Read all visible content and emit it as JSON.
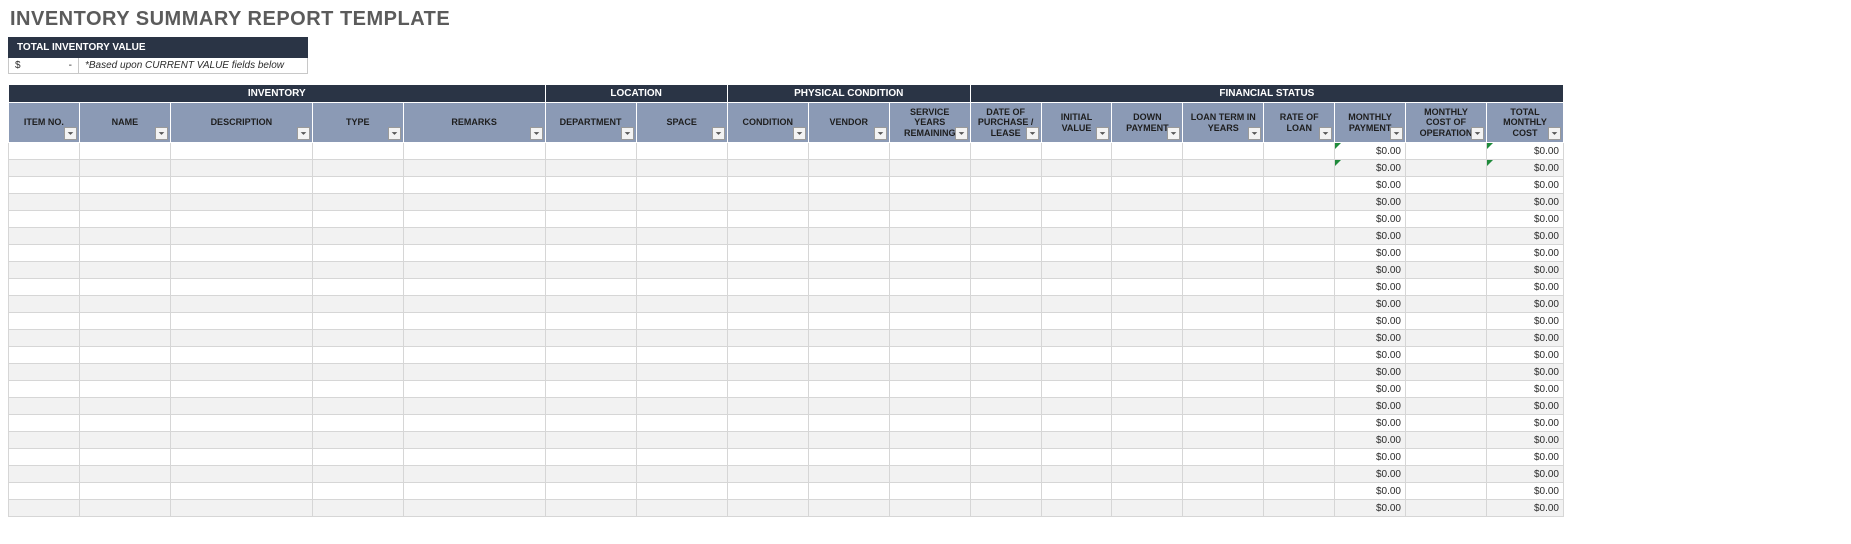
{
  "title": "INVENTORY SUMMARY REPORT TEMPLATE",
  "tiv": {
    "label": "TOTAL INVENTORY VALUE",
    "currency": "$",
    "value": "-",
    "note": "*Based upon CURRENT VALUE fields below"
  },
  "groups": {
    "inventory": "INVENTORY",
    "location": "LOCATION",
    "physical": "PHYSICAL CONDITION",
    "financial": "FINANCIAL STATUS"
  },
  "headers": {
    "itemno": "ITEM NO.",
    "name": "NAME",
    "description": "DESCRIPTION",
    "type": "TYPE",
    "remarks": "REMARKS",
    "department": "DEPARTMENT",
    "space": "SPACE",
    "condition": "CONDITION",
    "vendor": "VENDOR",
    "svcyears": "SERVICE YEARS REMAINING",
    "date": "DATE OF PURCHASE / LEASE",
    "initval": "INITIAL VALUE",
    "downpay": "DOWN PAYMENT",
    "loanterm": "LOAN TERM IN YEARS",
    "rate": "RATE OF LOAN",
    "mpay": "MONTHLY PAYMENT",
    "mcost": "MONTHLY COST OF OPERATION",
    "total": "TOTAL MONTHLY COST"
  },
  "rows": [
    {
      "mpay": "$0.00",
      "mcost": "",
      "total": "$0.00",
      "flag": true
    },
    {
      "mpay": "$0.00",
      "mcost": "",
      "total": "$0.00",
      "flag": true
    },
    {
      "mpay": "$0.00",
      "mcost": "",
      "total": "$0.00",
      "flag": false
    },
    {
      "mpay": "$0.00",
      "mcost": "",
      "total": "$0.00",
      "flag": false
    },
    {
      "mpay": "$0.00",
      "mcost": "",
      "total": "$0.00",
      "flag": false
    },
    {
      "mpay": "$0.00",
      "mcost": "",
      "total": "$0.00",
      "flag": false
    },
    {
      "mpay": "$0.00",
      "mcost": "",
      "total": "$0.00",
      "flag": false
    },
    {
      "mpay": "$0.00",
      "mcost": "",
      "total": "$0.00",
      "flag": false
    },
    {
      "mpay": "$0.00",
      "mcost": "",
      "total": "$0.00",
      "flag": false
    },
    {
      "mpay": "$0.00",
      "mcost": "",
      "total": "$0.00",
      "flag": false
    },
    {
      "mpay": "$0.00",
      "mcost": "",
      "total": "$0.00",
      "flag": false
    },
    {
      "mpay": "$0.00",
      "mcost": "",
      "total": "$0.00",
      "flag": false
    },
    {
      "mpay": "$0.00",
      "mcost": "",
      "total": "$0.00",
      "flag": false
    },
    {
      "mpay": "$0.00",
      "mcost": "",
      "total": "$0.00",
      "flag": false
    },
    {
      "mpay": "$0.00",
      "mcost": "",
      "total": "$0.00",
      "flag": false
    },
    {
      "mpay": "$0.00",
      "mcost": "",
      "total": "$0.00",
      "flag": false
    },
    {
      "mpay": "$0.00",
      "mcost": "",
      "total": "$0.00",
      "flag": false
    },
    {
      "mpay": "$0.00",
      "mcost": "",
      "total": "$0.00",
      "flag": false
    },
    {
      "mpay": "$0.00",
      "mcost": "",
      "total": "$0.00",
      "flag": false
    },
    {
      "mpay": "$0.00",
      "mcost": "",
      "total": "$0.00",
      "flag": false
    },
    {
      "mpay": "$0.00",
      "mcost": "",
      "total": "$0.00",
      "flag": false
    },
    {
      "mpay": "$0.00",
      "mcost": "",
      "total": "$0.00",
      "flag": false
    }
  ]
}
